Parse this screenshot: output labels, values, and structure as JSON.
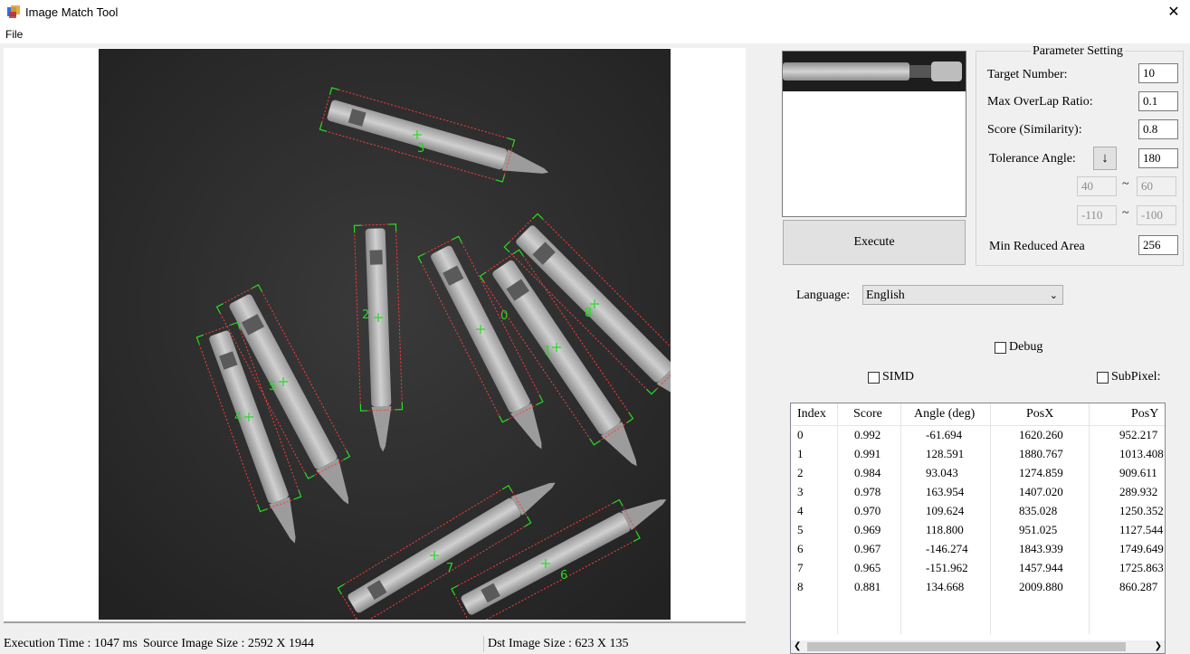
{
  "window": {
    "title": "Image Match Tool",
    "close": "✕"
  },
  "menu": {
    "file": "File"
  },
  "execute_label": "Execute",
  "params": {
    "legend": "Parameter Setting",
    "target_number_label": "Target Number:",
    "target_number": "10",
    "max_overlap_label": "Max OverLap Ratio:",
    "max_overlap": "0.1",
    "score_label": "Score (Similarity):",
    "score": "0.8",
    "tolerance_angle_label": "Tolerance Angle:",
    "tolerance_arrow": "↓",
    "tolerance_angle": "180",
    "range1_min": "40",
    "range1_max": "60",
    "range2_min": "-110",
    "range2_max": "-100",
    "tilde": "~",
    "min_reduced_area_label": "Min Reduced Area",
    "min_reduced_area": "256"
  },
  "language": {
    "label": "Language:",
    "selected": "English"
  },
  "checkboxes": {
    "debug": "Debug",
    "simd": "SIMD",
    "subpixel": "SubPixel:"
  },
  "table": {
    "headers": [
      "Index",
      "Score",
      "Angle (deg)",
      "PosX",
      "PosY"
    ],
    "rows": [
      [
        "0",
        "0.992",
        "-61.694",
        "1620.260",
        "952.217"
      ],
      [
        "1",
        "0.991",
        "128.591",
        "1880.767",
        "1013.408"
      ],
      [
        "2",
        "0.984",
        "93.043",
        "1274.859",
        "909.611"
      ],
      [
        "3",
        "0.978",
        "163.954",
        "1407.020",
        "289.932"
      ],
      [
        "4",
        "0.970",
        "109.624",
        "835.028",
        "1250.352"
      ],
      [
        "5",
        "0.969",
        "118.800",
        "951.025",
        "1127.544"
      ],
      [
        "6",
        "0.967",
        "-146.274",
        "1843.939",
        "1749.649"
      ],
      [
        "7",
        "0.965",
        "-151.962",
        "1457.944",
        "1725.863"
      ],
      [
        "8",
        "0.881",
        "134.668",
        "2009.880",
        "860.287"
      ]
    ]
  },
  "status": {
    "execution_time": "Execution Time : 1047 ms",
    "source_size": "Source Image Size : 2592 X 1944",
    "dst_size": "Dst Image Size : 623 X 135"
  },
  "colors": {
    "match_box": "#ff3b3b",
    "match_center": "#22dd22",
    "image_bg": "#2b2b2b"
  },
  "match_labels": [
    "0",
    "1",
    "2",
    "3",
    "4",
    "5",
    "6",
    "7",
    "8"
  ]
}
